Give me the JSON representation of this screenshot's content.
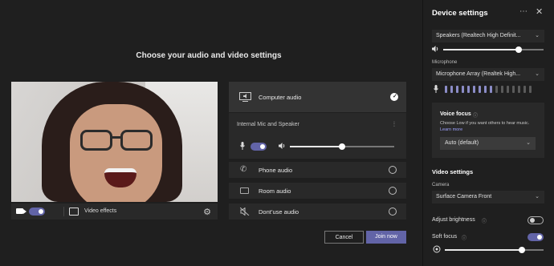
{
  "main": {
    "title": "Choose your audio and video settings",
    "video_effects_label": "Video effects",
    "audio_options": {
      "computer_audio": "Computer audio",
      "internal_device": "Internal Mic and Speaker",
      "speaker_volume": 0.5,
      "phone_audio": "Phone audio",
      "room_audio": "Room audio",
      "dont_use_audio": "Dont’use audio"
    },
    "cancel_label": "Cancel",
    "join_label": "Join now"
  },
  "device_settings": {
    "title": "Device settings",
    "more_icon": "⋯",
    "close_icon": "✕",
    "speaker_select": "Speakers (Realtech High Definit...",
    "speaker_volume": 0.75,
    "microphone_label": "Microphone",
    "microphone_select": "Microphone Array (Realtek High...",
    "mic_level_bars": 16,
    "mic_level_active": 9,
    "voice_focus": {
      "title": "Voice focus",
      "description": "Choose Low if you want others to hear music.",
      "learn_more": "Learn more",
      "selected": "Auto (default)"
    },
    "video_settings_title": "Video settings",
    "camera_label": "Camera",
    "camera_select": "Surface Camera Front",
    "adjust_brightness_label": "Adjust brightness",
    "adjust_brightness_on": false,
    "soft_focus_label": "Soft focus",
    "soft_focus_on": true,
    "soft_focus_level": 0.78
  },
  "colors": {
    "accent": "#6264a7",
    "background": "#1f1f1f",
    "panel": "#292929",
    "mic_level_active": "#8b8cc7",
    "mic_level_inactive": "#5a5a5a"
  }
}
